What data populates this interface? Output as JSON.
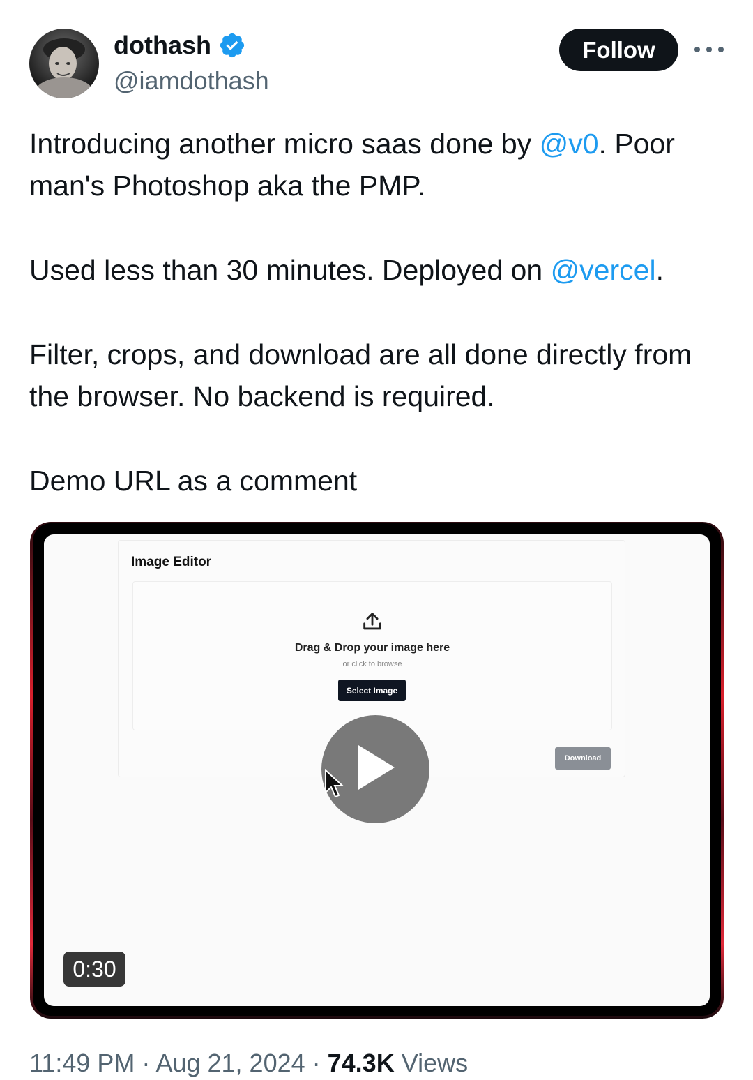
{
  "author": {
    "display_name": "dothash",
    "handle": "@iamdothash",
    "verified_icon": "verified-badge-icon",
    "avatar_icon": "avatar-photo"
  },
  "actions": {
    "follow_label": "Follow",
    "more_icon": "more-options-icon"
  },
  "tweet": {
    "p1_a": "Introducing another micro saas done by ",
    "p1_mention": "@v0",
    "p1_b": ". Poor man's Photoshop aka the PMP.",
    "p2_a": "Used less than 30 minutes. Deployed on ",
    "p2_mention": "@vercel",
    "p2_b": ".",
    "p3": "Filter, crops, and download are all done directly from the browser. No backend is required.",
    "p4": "Demo URL as a comment"
  },
  "media": {
    "editor_title": "Image Editor",
    "dropzone_title": "Drag & Drop your image here",
    "dropzone_sub": "or click to browse",
    "select_label": "Select Image",
    "download_label": "Download",
    "duration": "0:30",
    "play_icon": "play-icon",
    "upload_icon": "upload-icon"
  },
  "meta": {
    "time": "11:49 PM",
    "sep1": " · ",
    "date": "Aug 21, 2024",
    "sep2": " · ",
    "views_count": "74.3K",
    "views_label": " Views"
  },
  "colors": {
    "accent": "#1d9bf0",
    "text": "#0f1419",
    "secondary": "#536471"
  }
}
